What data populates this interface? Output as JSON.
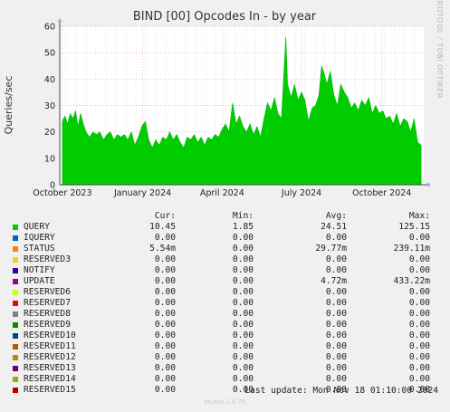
{
  "chart_data": {
    "type": "area",
    "title": "BIND [00] Opcodes In - by year",
    "ylabel": "Queries/sec",
    "xlabel": "",
    "ylim": [
      0,
      60
    ],
    "yticks": [
      "0",
      "10",
      "20",
      "30",
      "40",
      "50",
      "60"
    ],
    "xticks": [
      {
        "date": "2023-10-01",
        "label": "October 2023"
      },
      {
        "date": "2024-01-01",
        "label": "January 2024"
      },
      {
        "date": "2024-04-01",
        "label": "April 2024"
      },
      {
        "date": "2024-07-01",
        "label": "July 2024"
      },
      {
        "date": "2024-10-01",
        "label": "October 2024"
      }
    ],
    "x_range": [
      "2023-09-28",
      "2024-11-18"
    ],
    "grid": true,
    "series": [
      {
        "name": "QUERY",
        "color": "#00cc00",
        "points": [
          [
            "2023-10-01",
            24
          ],
          [
            "2023-10-04",
            26
          ],
          [
            "2023-10-07",
            23
          ],
          [
            "2023-10-10",
            27
          ],
          [
            "2023-10-13",
            25
          ],
          [
            "2023-10-16",
            28
          ],
          [
            "2023-10-19",
            22
          ],
          [
            "2023-10-22",
            27
          ],
          [
            "2023-10-25",
            23
          ],
          [
            "2023-10-28",
            20
          ],
          [
            "2023-11-01",
            18
          ],
          [
            "2023-11-05",
            20
          ],
          [
            "2023-11-09",
            19
          ],
          [
            "2023-11-13",
            20
          ],
          [
            "2023-11-17",
            17
          ],
          [
            "2023-11-21",
            19
          ],
          [
            "2023-11-25",
            20
          ],
          [
            "2023-11-29",
            17
          ],
          [
            "2023-12-03",
            19
          ],
          [
            "2023-12-07",
            18
          ],
          [
            "2023-12-11",
            19
          ],
          [
            "2023-12-15",
            17
          ],
          [
            "2023-12-19",
            20
          ],
          [
            "2023-12-23",
            15
          ],
          [
            "2023-12-27",
            18
          ],
          [
            "2023-12-31",
            22
          ],
          [
            "2024-01-04",
            24
          ],
          [
            "2024-01-08",
            17
          ],
          [
            "2024-01-12",
            14
          ],
          [
            "2024-01-16",
            17
          ],
          [
            "2024-01-20",
            15
          ],
          [
            "2024-01-24",
            18
          ],
          [
            "2024-01-28",
            17
          ],
          [
            "2024-02-01",
            20
          ],
          [
            "2024-02-05",
            17
          ],
          [
            "2024-02-09",
            19
          ],
          [
            "2024-02-13",
            16
          ],
          [
            "2024-02-17",
            14
          ],
          [
            "2024-02-21",
            18
          ],
          [
            "2024-02-25",
            17
          ],
          [
            "2024-02-29",
            19
          ],
          [
            "2024-03-04",
            16
          ],
          [
            "2024-03-08",
            18
          ],
          [
            "2024-03-12",
            15
          ],
          [
            "2024-03-16",
            18
          ],
          [
            "2024-03-20",
            17
          ],
          [
            "2024-03-24",
            19
          ],
          [
            "2024-03-28",
            18
          ],
          [
            "2024-04-01",
            21
          ],
          [
            "2024-04-05",
            23
          ],
          [
            "2024-04-09",
            20
          ],
          [
            "2024-04-13",
            31
          ],
          [
            "2024-04-17",
            23
          ],
          [
            "2024-04-21",
            26
          ],
          [
            "2024-04-25",
            22
          ],
          [
            "2024-04-29",
            20
          ],
          [
            "2024-05-03",
            23
          ],
          [
            "2024-05-07",
            19
          ],
          [
            "2024-05-11",
            22
          ],
          [
            "2024-05-15",
            18
          ],
          [
            "2024-05-19",
            25
          ],
          [
            "2024-05-23",
            31
          ],
          [
            "2024-05-27",
            28
          ],
          [
            "2024-05-31",
            33
          ],
          [
            "2024-06-04",
            27
          ],
          [
            "2024-06-08",
            25
          ],
          [
            "2024-06-11",
            44
          ],
          [
            "2024-06-13",
            56
          ],
          [
            "2024-06-15",
            38
          ],
          [
            "2024-06-19",
            33
          ],
          [
            "2024-06-23",
            38
          ],
          [
            "2024-06-27",
            32
          ],
          [
            "2024-07-01",
            35
          ],
          [
            "2024-07-05",
            32
          ],
          [
            "2024-07-09",
            24
          ],
          [
            "2024-07-13",
            29
          ],
          [
            "2024-07-17",
            30
          ],
          [
            "2024-07-21",
            34
          ],
          [
            "2024-07-24",
            45
          ],
          [
            "2024-07-27",
            42
          ],
          [
            "2024-07-30",
            38
          ],
          [
            "2024-08-03",
            43
          ],
          [
            "2024-08-07",
            34
          ],
          [
            "2024-08-11",
            30
          ],
          [
            "2024-08-15",
            38
          ],
          [
            "2024-08-19",
            35
          ],
          [
            "2024-08-23",
            33
          ],
          [
            "2024-08-27",
            29
          ],
          [
            "2024-08-31",
            31
          ],
          [
            "2024-09-04",
            28
          ],
          [
            "2024-09-08",
            32
          ],
          [
            "2024-09-12",
            30
          ],
          [
            "2024-09-16",
            33
          ],
          [
            "2024-09-20",
            27
          ],
          [
            "2024-09-24",
            30
          ],
          [
            "2024-09-28",
            27
          ],
          [
            "2024-10-02",
            28
          ],
          [
            "2024-10-06",
            25
          ],
          [
            "2024-10-10",
            26
          ],
          [
            "2024-10-14",
            23
          ],
          [
            "2024-10-18",
            27
          ],
          [
            "2024-10-22",
            22
          ],
          [
            "2024-10-26",
            25
          ],
          [
            "2024-10-30",
            24
          ],
          [
            "2024-11-03",
            20
          ],
          [
            "2024-11-07",
            25
          ],
          [
            "2024-11-11",
            16
          ],
          [
            "2024-11-15",
            15
          ]
        ]
      }
    ]
  },
  "legend": {
    "headers": [
      "Cur:",
      "Min:",
      "Avg:",
      "Max:"
    ],
    "rows": [
      {
        "name": "QUERY",
        "color": "#00cc00",
        "cur": "10.45",
        "min": "1.85",
        "avg": "24.51",
        "max": "125.15"
      },
      {
        "name": "IQUERY",
        "color": "#0066b3",
        "cur": "0.00",
        "min": "0.00",
        "avg": "0.00",
        "max": "0.00"
      },
      {
        "name": "STATUS",
        "color": "#ff8000",
        "cur": "5.54m",
        "min": "0.00",
        "avg": "29.77m",
        "max": "239.11m"
      },
      {
        "name": "RESERVED3",
        "color": "#ffcc00",
        "cur": "0.00",
        "min": "0.00",
        "avg": "0.00",
        "max": "0.00"
      },
      {
        "name": "NOTIFY",
        "color": "#330099",
        "cur": "0.00",
        "min": "0.00",
        "avg": "0.00",
        "max": "0.00"
      },
      {
        "name": "UPDATE",
        "color": "#990099",
        "cur": "0.00",
        "min": "0.00",
        "avg": "4.72m",
        "max": "433.22m"
      },
      {
        "name": "RESERVED6",
        "color": "#ccff00",
        "cur": "0.00",
        "min": "0.00",
        "avg": "0.00",
        "max": "0.00"
      },
      {
        "name": "RESERVED7",
        "color": "#ff0000",
        "cur": "0.00",
        "min": "0.00",
        "avg": "0.00",
        "max": "0.00"
      },
      {
        "name": "RESERVED8",
        "color": "#808080",
        "cur": "0.00",
        "min": "0.00",
        "avg": "0.00",
        "max": "0.00"
      },
      {
        "name": "RESERVED9",
        "color": "#008f00",
        "cur": "0.00",
        "min": "0.00",
        "avg": "0.00",
        "max": "0.00"
      },
      {
        "name": "RESERVED10",
        "color": "#00487d",
        "cur": "0.00",
        "min": "0.00",
        "avg": "0.00",
        "max": "0.00"
      },
      {
        "name": "RESERVED11",
        "color": "#b35a00",
        "cur": "0.00",
        "min": "0.00",
        "avg": "0.00",
        "max": "0.00"
      },
      {
        "name": "RESERVED12",
        "color": "#b38f00",
        "cur": "0.00",
        "min": "0.00",
        "avg": "0.00",
        "max": "0.00"
      },
      {
        "name": "RESERVED13",
        "color": "#6b006b",
        "cur": "0.00",
        "min": "0.00",
        "avg": "0.00",
        "max": "0.00"
      },
      {
        "name": "RESERVED14",
        "color": "#8fb300",
        "cur": "0.00",
        "min": "0.00",
        "avg": "0.00",
        "max": "0.00"
      },
      {
        "name": "RESERVED15",
        "color": "#b30000",
        "cur": "0.00",
        "min": "0.00",
        "avg": "0.00",
        "max": "0.00"
      }
    ]
  },
  "last_update": "Last update: Mon Nov 18 01:10:00 2024",
  "side_label": "RRDTOOL / TOBI OETIKER",
  "footer": "Munin 2.0.76"
}
